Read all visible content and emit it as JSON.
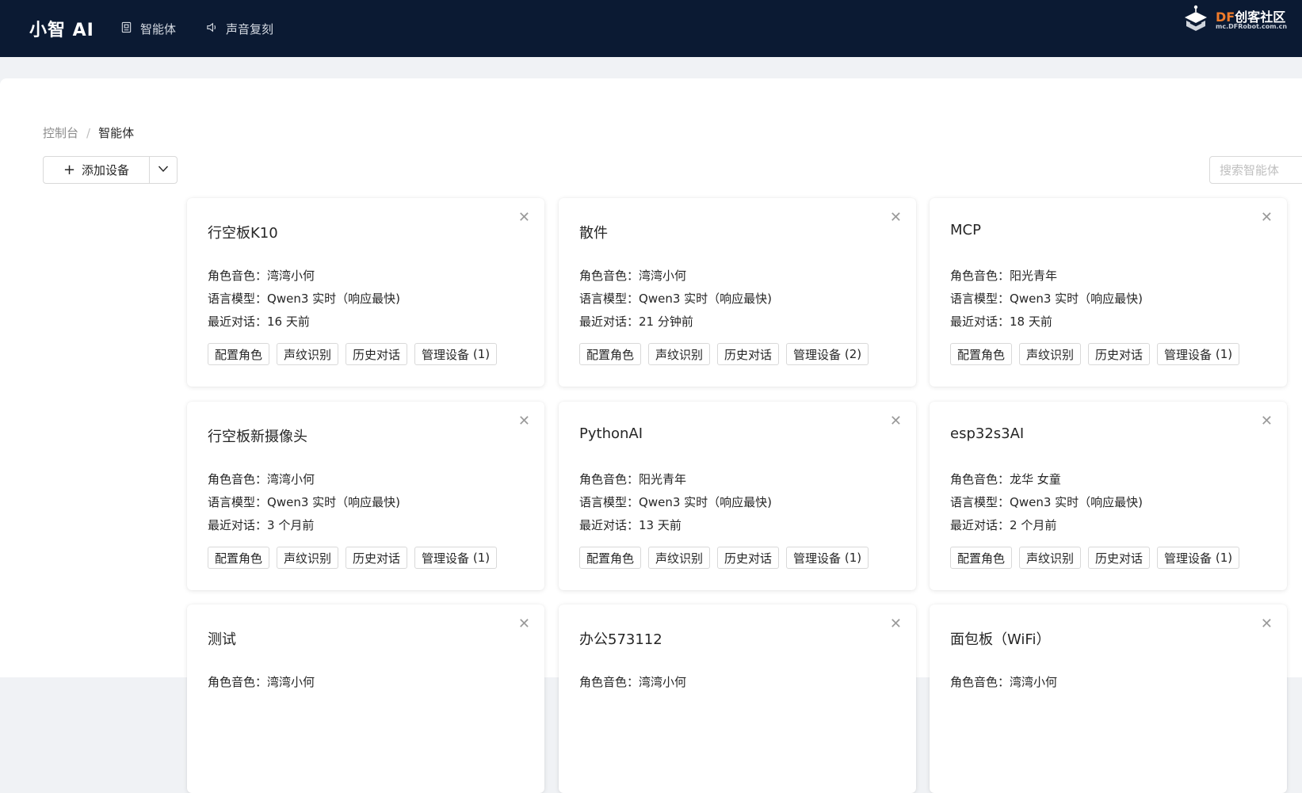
{
  "header": {
    "brand": "小智 AI",
    "nav": [
      {
        "label": "智能体",
        "icon": "agent-icon"
      },
      {
        "label": "声音复刻",
        "icon": "speaker-icon"
      }
    ],
    "partner_logo": {
      "main_prefix": "DF",
      "main_rest": "创客社区",
      "sub": "mc.DFRobot.com.cn",
      "accent": "#f07b2a"
    }
  },
  "breadcrumb": {
    "root": "控制台",
    "separator": "/",
    "current": "智能体"
  },
  "toolbar": {
    "add_label": "添加设备",
    "search_placeholder": "搜索智能体"
  },
  "labels": {
    "voice": "角色音色：",
    "model": "语言模型：",
    "recent": "最近对话：",
    "configure": "配置角色",
    "voiceprint": "声纹识别",
    "history": "历史对话",
    "manage": "管理设备"
  },
  "agents": [
    {
      "name": "行空板K10",
      "voice": "湾湾小何",
      "model": "Qwen3 实时（响应最快)",
      "recent": "16 天前",
      "devices": "(1)"
    },
    {
      "name": "散件",
      "voice": "湾湾小何",
      "model": "Qwen3 实时（响应最快)",
      "recent": "21 分钟前",
      "devices": "(2)"
    },
    {
      "name": "MCP",
      "voice": "阳光青年",
      "model": "Qwen3 实时（响应最快)",
      "recent": "18 天前",
      "devices": "(1)"
    },
    {
      "name": "行空板新摄像头",
      "voice": "湾湾小何",
      "model": "Qwen3 实时（响应最快)",
      "recent": "3 个月前",
      "devices": "(1)"
    },
    {
      "name": "PythonAI",
      "voice": "阳光青年",
      "model": "Qwen3 实时（响应最快)",
      "recent": "13 天前",
      "devices": "(1)"
    },
    {
      "name": "esp32s3AI",
      "voice": "龙华 女童",
      "model": "Qwen3 实时（响应最快)",
      "recent": "2 个月前",
      "devices": "(1)"
    },
    {
      "name": "测试",
      "voice": "湾湾小何",
      "model": "",
      "recent": "",
      "devices": ""
    },
    {
      "name": "办公573112",
      "voice": "湾湾小何",
      "model": "",
      "recent": "",
      "devices": ""
    },
    {
      "name": "面包板（WiFi）",
      "voice": "湾湾小何",
      "model": "",
      "recent": "",
      "devices": ""
    }
  ],
  "colors": {
    "header_bg": "#0b1a33",
    "page_bg": "#f0f2f5"
  }
}
